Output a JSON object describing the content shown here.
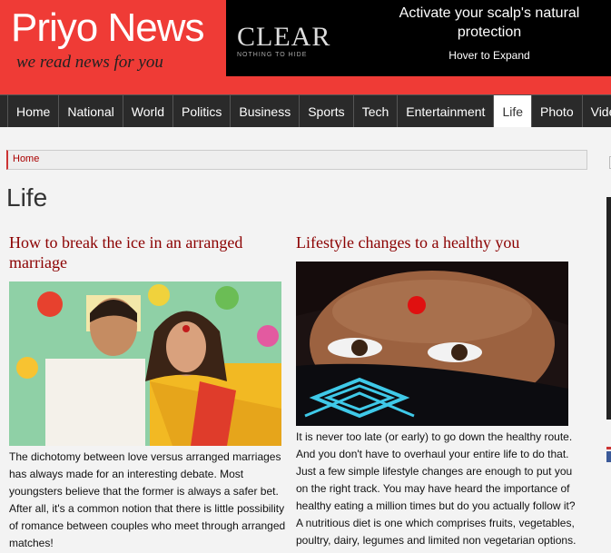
{
  "header": {
    "logo": "Priyo News",
    "tagline": "we read news for you"
  },
  "ad": {
    "brand": "CLEAR",
    "brand_sub": "NOTHING TO HIDE",
    "headline": "Activate your scalp's natural protection",
    "cta": "Hover to Expand"
  },
  "nav": {
    "items": [
      "Home",
      "National",
      "World",
      "Politics",
      "Business",
      "Sports",
      "Tech",
      "Entertainment",
      "Life",
      "Photo",
      "Video"
    ],
    "active": "Life"
  },
  "breadcrumb": {
    "home": "Home"
  },
  "page": {
    "title": "Life"
  },
  "articles": [
    {
      "title": "How to break the ice in an arranged marriage",
      "text": "The dichotomy between love versus arranged marriages has always made for an interesting debate. Most youngsters believe that the former is always a safer bet. After all, it's a common notion that there is little possibility of romance between couples who meet through arranged matches!"
    },
    {
      "title": "Lifestyle changes to a healthy you",
      "text": "It is never too late (or early) to go down the healthy route. And you don't have to overhaul your entire life to do that. Just a few simple lifestyle changes are enough to put you on the right track. You may have heard the importance of healthy eating a million times but do you actually follow it? A nutritious diet is one which comprises fruits, vegetables, poultry, dairy, legumes and limited non vegetarian options."
    }
  ]
}
